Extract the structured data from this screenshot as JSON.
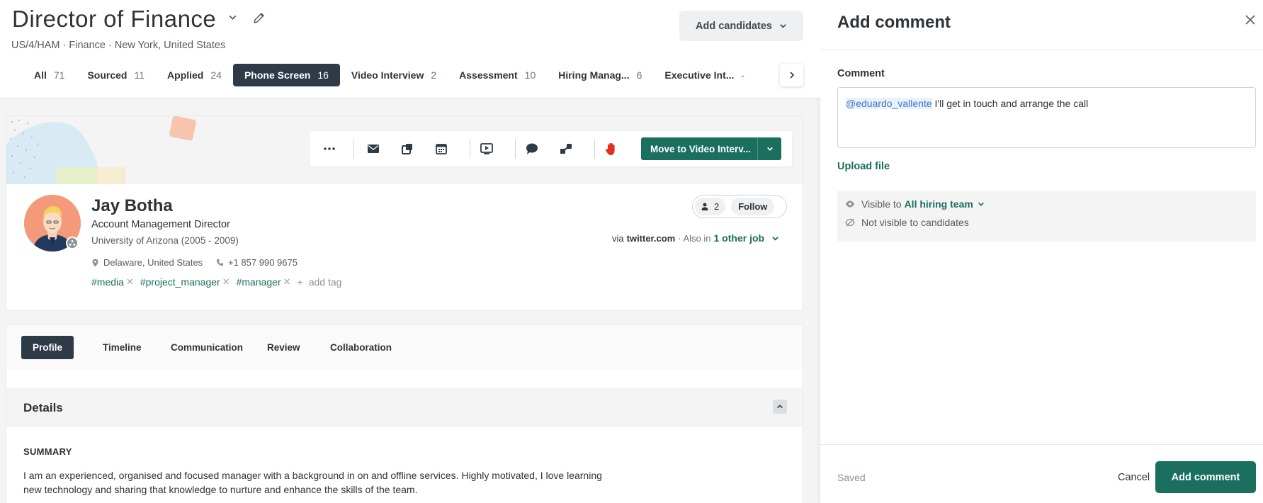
{
  "job": {
    "title": "Director of Finance",
    "subtitle": "US/4/HAM · Finance · New York, United States",
    "add_candidates_label": "Add candidates"
  },
  "stages": [
    {
      "label": "All",
      "count": "71"
    },
    {
      "label": "Sourced",
      "count": "11"
    },
    {
      "label": "Applied",
      "count": "24"
    },
    {
      "label": "Phone Screen",
      "count": "16"
    },
    {
      "label": "Video Interview",
      "count": "2"
    },
    {
      "label": "Assessment",
      "count": "10"
    },
    {
      "label": "Hiring Manag...",
      "count": "6"
    },
    {
      "label": "Executive Int...",
      "count": "-"
    }
  ],
  "active_stage": "Phone Screen",
  "actions": {
    "icons": [
      "more-icon",
      "email-icon",
      "share-icon",
      "calendar-icon",
      "video-icon",
      "comment-icon",
      "link-icon",
      "stop-hand-icon"
    ],
    "move_label": "Move to Video Interv..."
  },
  "candidate": {
    "name": "Jay Botha",
    "role": "Account Management Director",
    "education": "University of Arizona (2005 - 2009)",
    "location": "Delaware, United States",
    "phone": "+1 857 990 9675",
    "tags": [
      "#media",
      "#project_manager",
      "#manager"
    ],
    "add_tag_label": "add tag",
    "followers_count": "2",
    "follow_label": "Follow",
    "via_prefix": "via",
    "source": "twitter.com",
    "also_in": "· Also in",
    "other_jobs_link": "1 other job"
  },
  "profile_tabs": [
    "Profile",
    "Timeline",
    "Communication",
    "Review",
    "Collaboration"
  ],
  "active_profile_tab": "Profile",
  "details": {
    "heading": "Details",
    "summary_heading": "SUMMARY",
    "summary_text": "I am an experienced, organised and focused manager with a background in on and offline services. Highly motivated, I love learning new technology and sharing that knowledge to nurture and enhance the skills of the team."
  },
  "comment_panel": {
    "title": "Add comment",
    "comment_label": "Comment",
    "mention": "@eduardo_vallente",
    "comment_text": " I'll get in touch and arrange the call",
    "upload_label": "Upload file",
    "visible_prefix": "Visible to",
    "visible_to": "All hiring team",
    "not_visible": "Not visible to candidates",
    "saved_label": "Saved",
    "cancel_label": "Cancel",
    "submit_label": "Add comment"
  },
  "colors": {
    "brand_green": "#1a6f5e",
    "dark_tab": "#2e3a45",
    "stop_red": "#e0301e",
    "mention_blue": "#3b78c9"
  }
}
